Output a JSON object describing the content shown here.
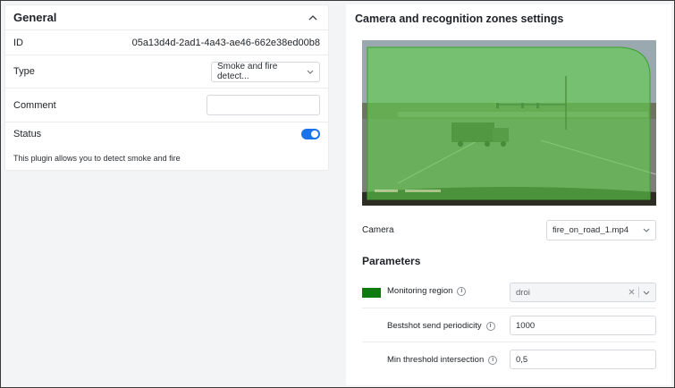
{
  "general": {
    "title": "General",
    "id_label": "ID",
    "id_value": "05a13d4d-2ad1-4a43-ae46-662e38ed00b8",
    "type_label": "Type",
    "type_value": "Smoke and fire detect...",
    "comment_label": "Comment",
    "comment_value": "",
    "status_label": "Status",
    "status_enabled": true,
    "description": "This plugin allows you to detect smoke and fire"
  },
  "settings": {
    "title": "Camera and recognition zones settings",
    "camera_label": "Camera",
    "camera_value": "fire_on_road_1.mp4",
    "params_title": "Parameters",
    "monitoring_region_label": "Monitoring region",
    "monitoring_region_value": "droi",
    "monitoring_region_color": "#0f7a0f",
    "bestshot_label": "Bestshot send periodicity",
    "bestshot_value": "1000",
    "min_threshold_label": "Min threshold intersection",
    "min_threshold_value": "0,5"
  },
  "colors": {
    "accent": "#1a73e8",
    "zone_overlay": "#5fce4a"
  },
  "icons": {
    "collapse": "chevron-up-icon",
    "dropdown": "chevron-down-icon",
    "info": "info-icon",
    "clear": "close-icon"
  }
}
